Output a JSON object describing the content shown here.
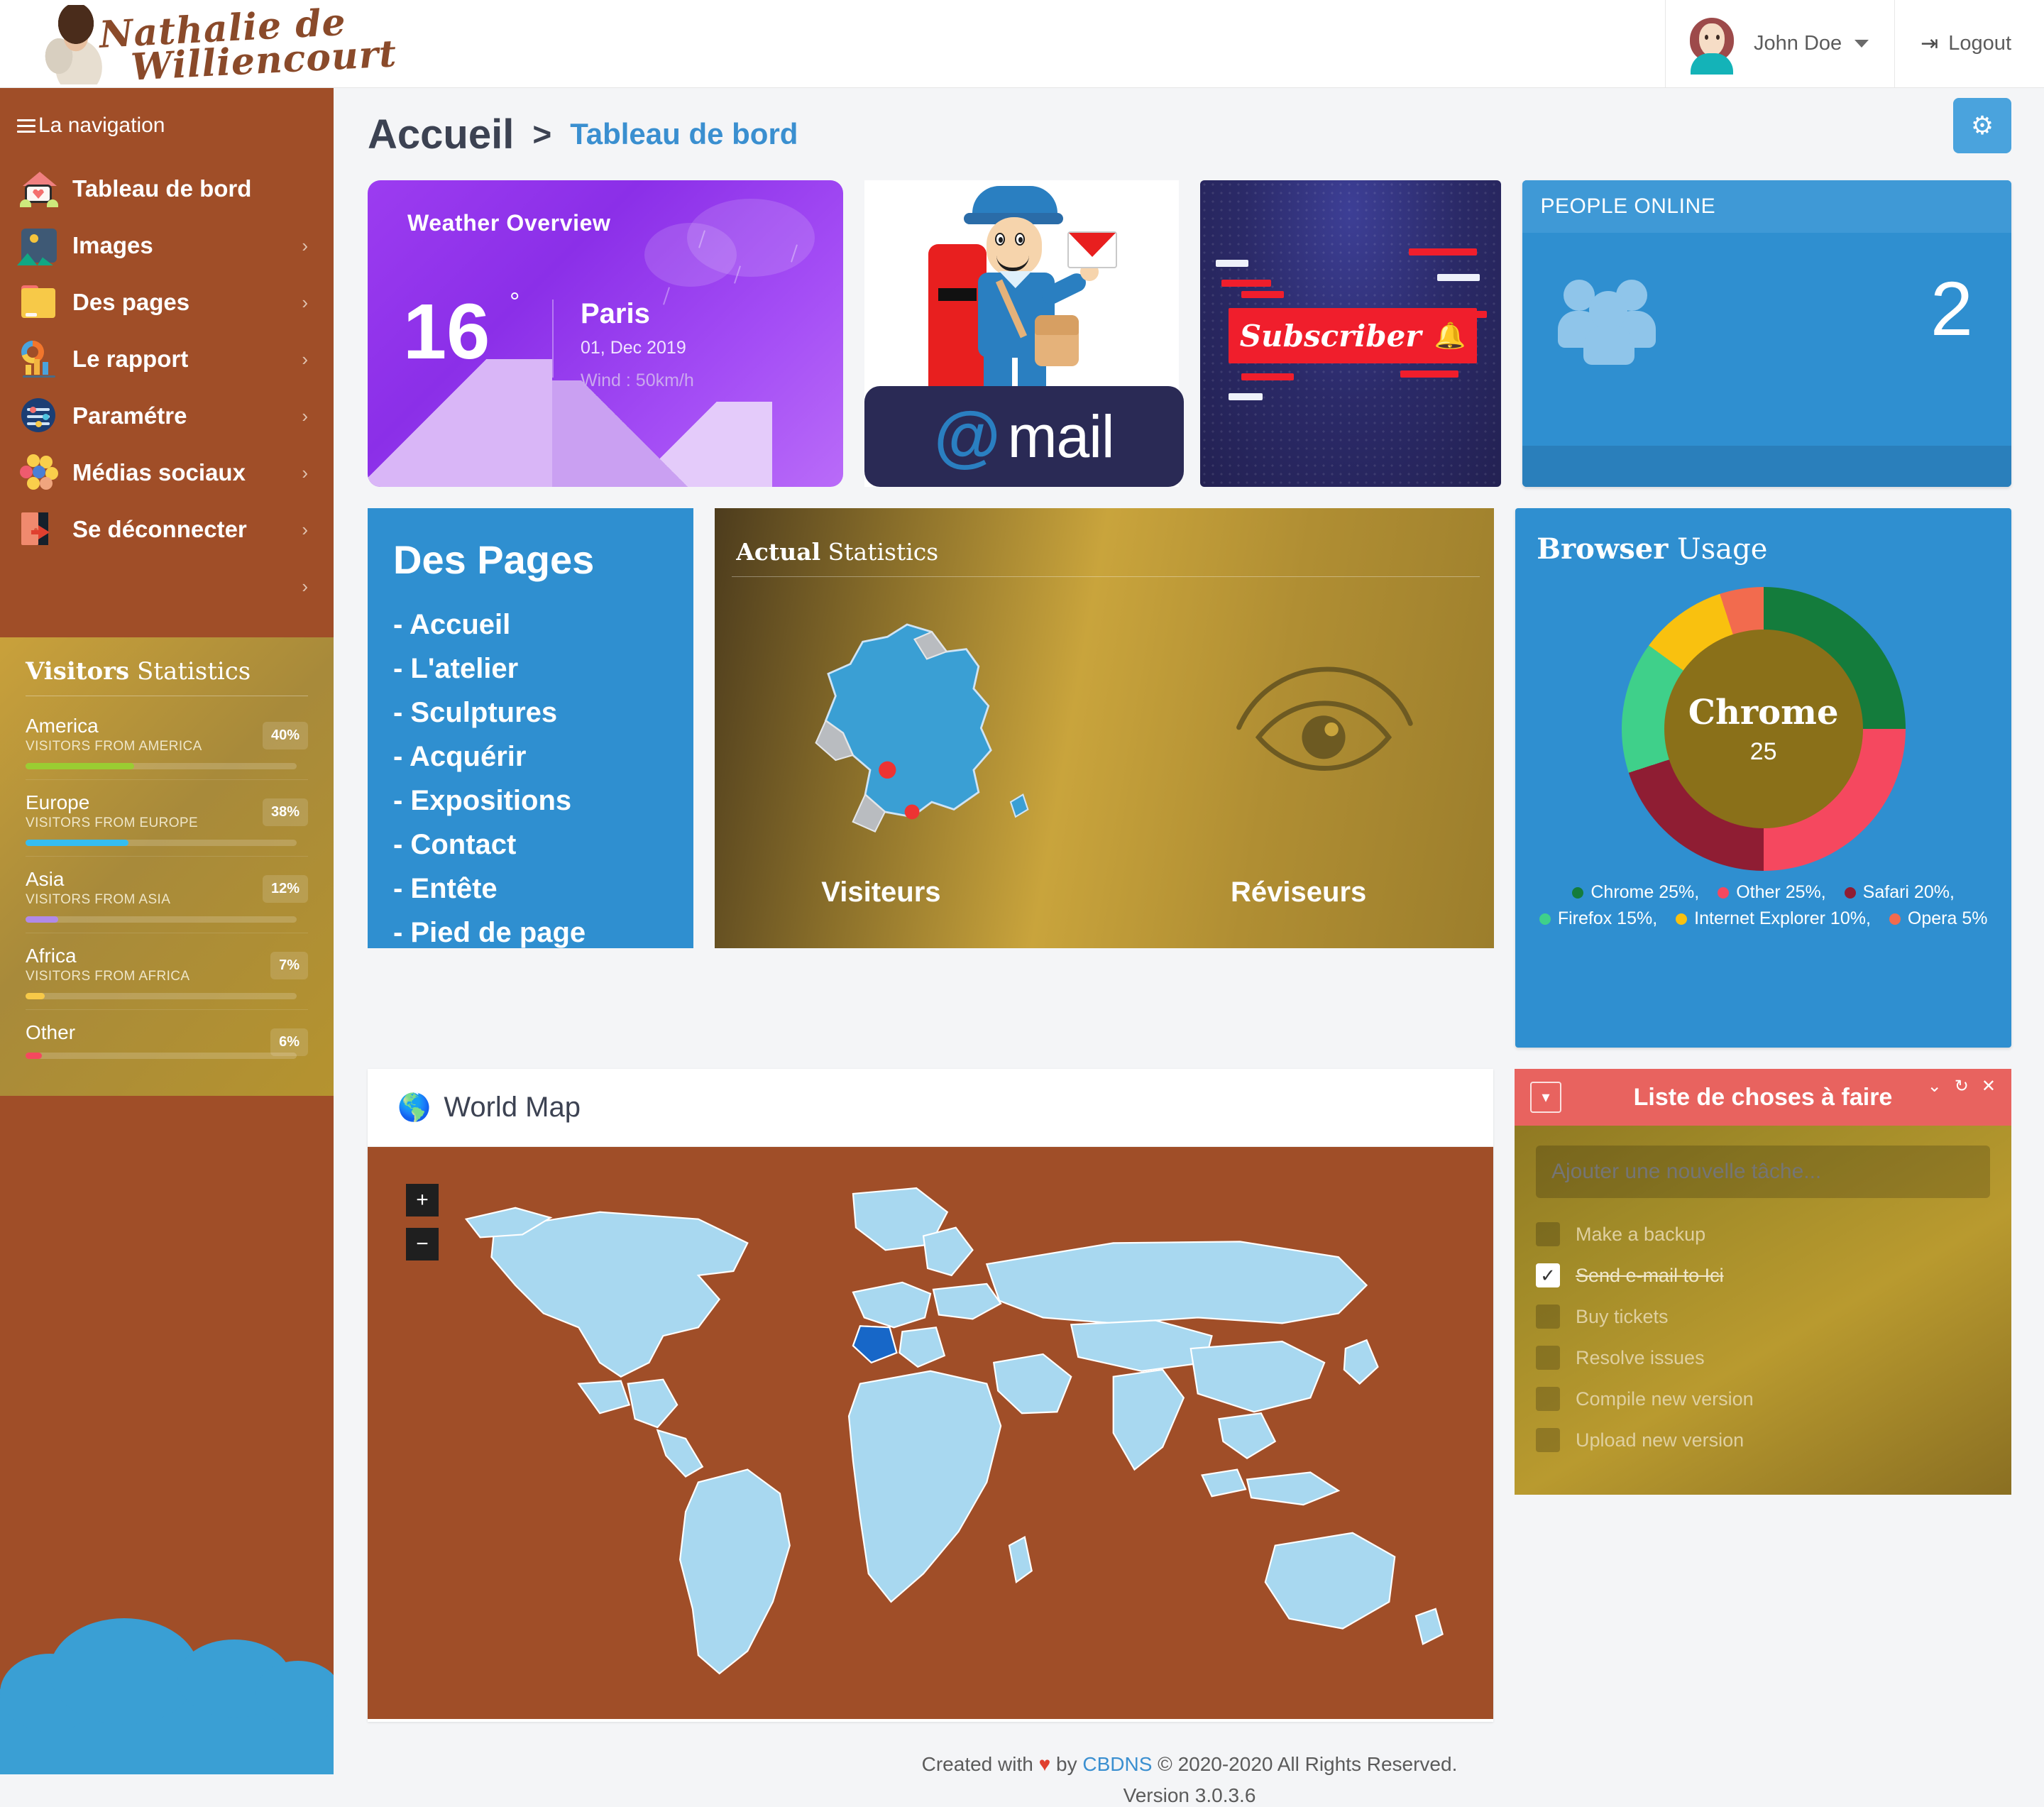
{
  "brand": {
    "line1": "Nathalie de",
    "line2": "Williencourt"
  },
  "topbar": {
    "user_name": "John Doe",
    "logout_label": "Logout",
    "logout_icon": "logout-icon",
    "caret_icon": "chevron-down-icon"
  },
  "sidebar": {
    "nav_title": "La navigation",
    "items": [
      {
        "label": "Tableau de bord",
        "icon": "home-heart-icon",
        "arrow": ""
      },
      {
        "label": "Images",
        "icon": "picture-icon",
        "arrow": "›"
      },
      {
        "label": "Des pages",
        "icon": "folder-icon",
        "arrow": "›"
      },
      {
        "label": "Le rapport",
        "icon": "chart-report-icon",
        "arrow": "›"
      },
      {
        "label": "Paramétre",
        "icon": "settings-sliders-icon",
        "arrow": "›"
      },
      {
        "label": "Médias sociaux",
        "icon": "social-emoji-icon",
        "arrow": "›"
      },
      {
        "label": "Se déconnecter",
        "icon": "exit-door-icon",
        "arrow": "›"
      }
    ],
    "stats": {
      "title_bold": "Visitors",
      "title_light": " Statistics",
      "rows": [
        {
          "name": "America",
          "desc": "VISITORS FROM AMERICA",
          "pct": "40%",
          "value": 40,
          "color": "#9acd32"
        },
        {
          "name": "Europe",
          "desc": "VISITORS FROM EUROPE",
          "pct": "38%",
          "value": 38,
          "color": "#35bdf0"
        },
        {
          "name": "Asia",
          "desc": "VISITORS FROM ASIA",
          "pct": "12%",
          "value": 12,
          "color": "#b18ae8"
        },
        {
          "name": "Africa",
          "desc": "VISITORS FROM AFRICA",
          "pct": "7%",
          "value": 7,
          "color": "#f7c948"
        },
        {
          "name": "Other",
          "desc": "",
          "pct": "6%",
          "value": 6,
          "color": "#f5485f"
        }
      ]
    }
  },
  "page": {
    "breadcrumb_main": "Accueil",
    "breadcrumb_sep": ">",
    "breadcrumb_sub": "Tableau de bord",
    "gear_icon": "gear-icon"
  },
  "weather": {
    "title": "Weather Overview",
    "temp": "16",
    "degree": "°",
    "city": "Paris",
    "date": "01, Dec 2019",
    "wind": "Wind : 50km/h"
  },
  "mail": {
    "at": "@",
    "word": "mail"
  },
  "subscriber": {
    "label": "Subscriber",
    "bell_icon": "bell-icon"
  },
  "people_online": {
    "title": "PEOPLE ONLINE",
    "count": "2",
    "icon": "users-group-icon"
  },
  "des_pages": {
    "title": "Des Pages",
    "items": [
      "- Accueil",
      "- L'atelier",
      "- Sculptures",
      "- Acquérir",
      "- Expositions",
      "- Contact",
      "- Entête",
      "- Pied de page"
    ]
  },
  "actual_stats": {
    "title_bold": "Actual",
    "title_light": " Statistics",
    "label_left": "Visiteurs",
    "label_right": "Réviseurs"
  },
  "browser_usage": {
    "title_bold": "Browser",
    "title_light": " Usage",
    "center_name": "Chrome",
    "center_value": "25"
  },
  "chart_data": {
    "type": "pie",
    "title": "Browser Usage",
    "categories": [
      "Chrome",
      "Other",
      "Safari",
      "Firefox",
      "Internet Explorer",
      "Opera"
    ],
    "values": [
      25,
      25,
      20,
      15,
      10,
      5
    ],
    "colors": [
      "#147c3c",
      "#f5485f",
      "#8f1d33",
      "#3fd08a",
      "#f9c10f",
      "#f26b4e"
    ],
    "legend_text": [
      "Chrome  25%,",
      "Other  25%,",
      "Safari  20%,",
      "Firefox  15%,",
      "Internet Explorer  10%,",
      "Opera  5%"
    ],
    "legend_position": "bottom",
    "center_label": "Chrome",
    "center_value": 25
  },
  "world_map": {
    "title": "World Map",
    "globe_icon": "globe-icon",
    "zoom_in": "+",
    "zoom_out": "−"
  },
  "todo": {
    "title": "Liste de choses à faire",
    "box_icon": "checkbox-square-icon",
    "controls": [
      "chevron-down-icon",
      "refresh-icon",
      "close-icon"
    ],
    "input_placeholder": "Ajouter une nouvelle tâche...",
    "items": [
      {
        "text": "Make a backup",
        "done": false
      },
      {
        "text": "Send e-mail to Ici",
        "done": true
      },
      {
        "text": "Buy tickets",
        "done": false
      },
      {
        "text": "Resolve issues",
        "done": false
      },
      {
        "text": "Compile new version",
        "done": false
      },
      {
        "text": "Upload new version",
        "done": false
      }
    ]
  },
  "footer": {
    "prefix": "Created with",
    "heart": "♥",
    "by": "by",
    "company": "CBDNS",
    "copyright": "© 2020-2020 All Rights Reserved.",
    "version": "Version 3.0.3.6"
  }
}
